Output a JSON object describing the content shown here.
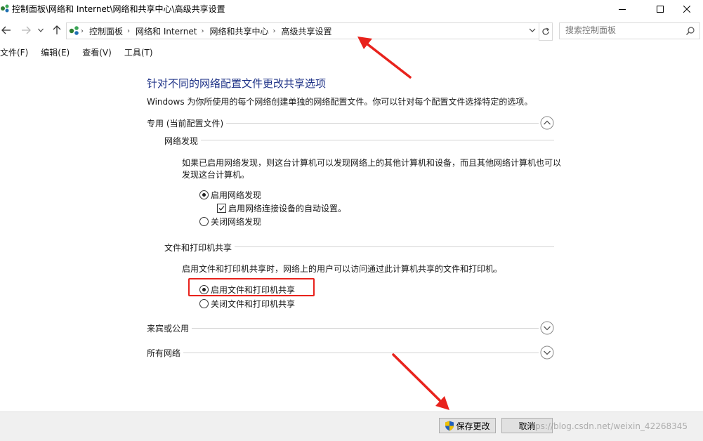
{
  "window": {
    "title": "控制面板\\网络和 Internet\\网络和共享中心\\高级共享设置"
  },
  "address": {
    "crumbs": [
      "控制面板",
      "网络和 Internet",
      "网络和共享中心",
      "高级共享设置"
    ]
  },
  "search": {
    "placeholder": "搜索控制面板"
  },
  "menu": {
    "items": [
      "文件(F)",
      "编辑(E)",
      "查看(V)",
      "工具(T)"
    ]
  },
  "main": {
    "heading": "针对不同的网络配置文件更改共享选项",
    "description": "Windows 为你所使用的每个网络创建单独的网络配置文件。你可以针对每个配置文件选择特定的选项。",
    "profiles": [
      {
        "label": "专用 (当前配置文件)",
        "expanded": true
      },
      {
        "label": "来宾或公用",
        "expanded": false
      },
      {
        "label": "所有网络",
        "expanded": false
      }
    ],
    "network_discovery": {
      "title": "网络发现",
      "description": "如果已启用网络发现，则这台计算机可以发现网络上的其他计算机和设备，而且其他网络计算机也可以发现这台计算机。",
      "option_on": "启用网络发现",
      "auto_setup": "启用网络连接设备的自动设置。",
      "option_off": "关闭网络发现",
      "selected": "on",
      "auto_setup_checked": true
    },
    "file_printer_sharing": {
      "title": "文件和打印机共享",
      "description": "启用文件和打印机共享时，网络上的用户可以访问通过此计算机共享的文件和打印机。",
      "option_on": "启用文件和打印机共享",
      "option_off": "关闭文件和打印机共享",
      "selected": "on"
    }
  },
  "footer": {
    "save_label": "保存更改",
    "cancel_label": "取消"
  },
  "watermark": "https://blog.csdn.net/weixin_42268345",
  "colors": {
    "heading": "#1e3287",
    "annotation": "#e8221c"
  }
}
